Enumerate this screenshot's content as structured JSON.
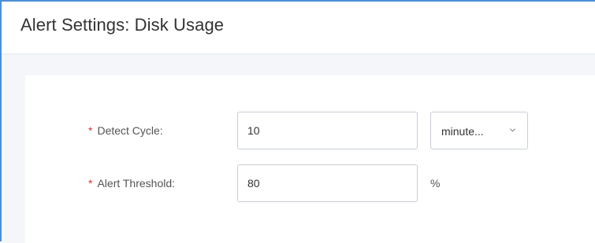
{
  "dialog": {
    "title": "Alert Settings: Disk Usage"
  },
  "form": {
    "detect_cycle": {
      "label": "Detect Cycle:",
      "required_mark": "*",
      "value": "10",
      "unit_select": {
        "selected": "minute..."
      }
    },
    "alert_threshold": {
      "label": "Alert Threshold:",
      "required_mark": "*",
      "value": "80",
      "unit": "%"
    }
  },
  "icons": {
    "select_chevron": "chevron-down-icon"
  },
  "colors": {
    "accent_border": "#4a90d9",
    "required": "#e0322f",
    "body_background": "#f4f6f9"
  }
}
